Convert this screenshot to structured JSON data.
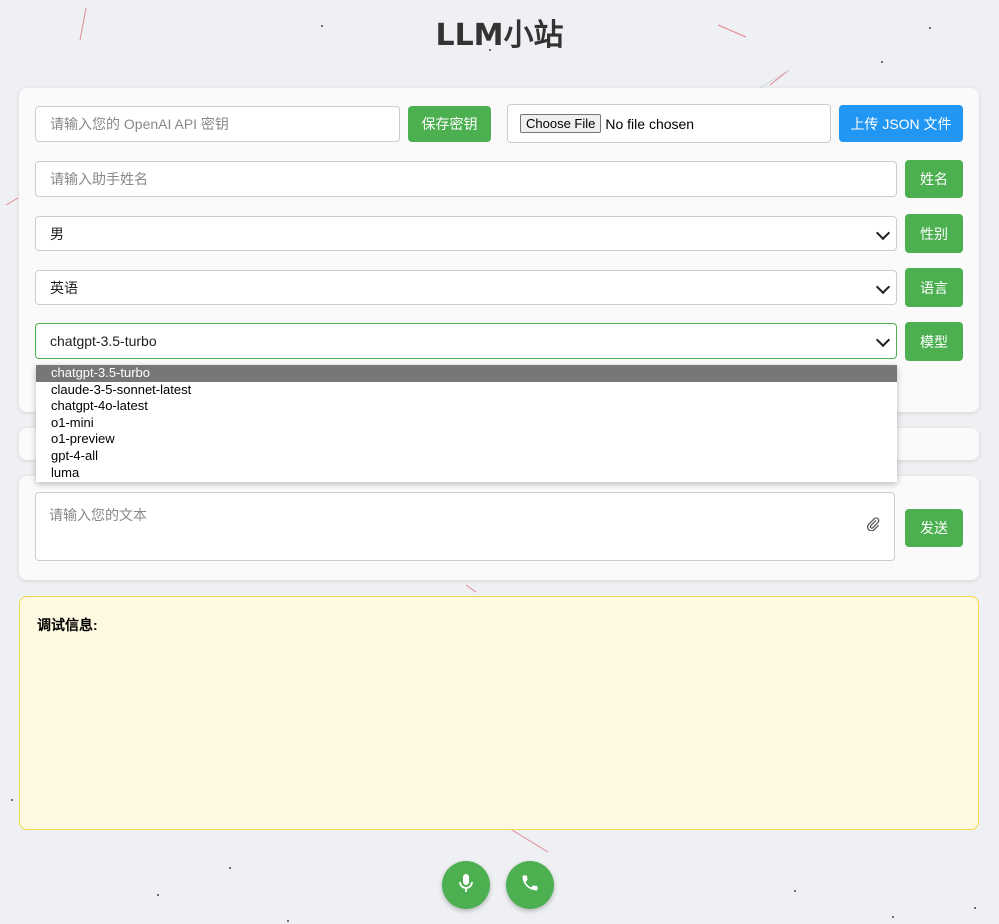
{
  "app": {
    "title": "LLM小站"
  },
  "api": {
    "placeholder": "请输入您的 OpenAI API 密钥",
    "save_label": "保存密钥"
  },
  "file": {
    "choose_label": "Choose File",
    "status": "No file chosen",
    "upload_label": "上传 JSON 文件"
  },
  "assistant": {
    "name_placeholder": "请输入助手姓名",
    "name_button": "姓名"
  },
  "gender": {
    "value": "男",
    "button": "性别"
  },
  "language": {
    "value": "英语",
    "button": "语言"
  },
  "model": {
    "value": "chatgpt-3.5-turbo",
    "button": "模型",
    "options": [
      "chatgpt-3.5-turbo",
      "claude-3-5-sonnet-latest",
      "chatgpt-4o-latest",
      "o1-mini",
      "o1-preview",
      "gpt-4-all",
      "luma"
    ]
  },
  "message": {
    "placeholder": "请输入您的文本",
    "send_label": "发送"
  },
  "debug": {
    "label": "调试信息:"
  },
  "icons": {
    "attach": "paperclip-icon",
    "mic": "microphone-icon",
    "call": "phone-icon"
  },
  "colors": {
    "green": "#4caf50",
    "blue": "#2196f3",
    "debug_bg": "#fff9e1"
  }
}
